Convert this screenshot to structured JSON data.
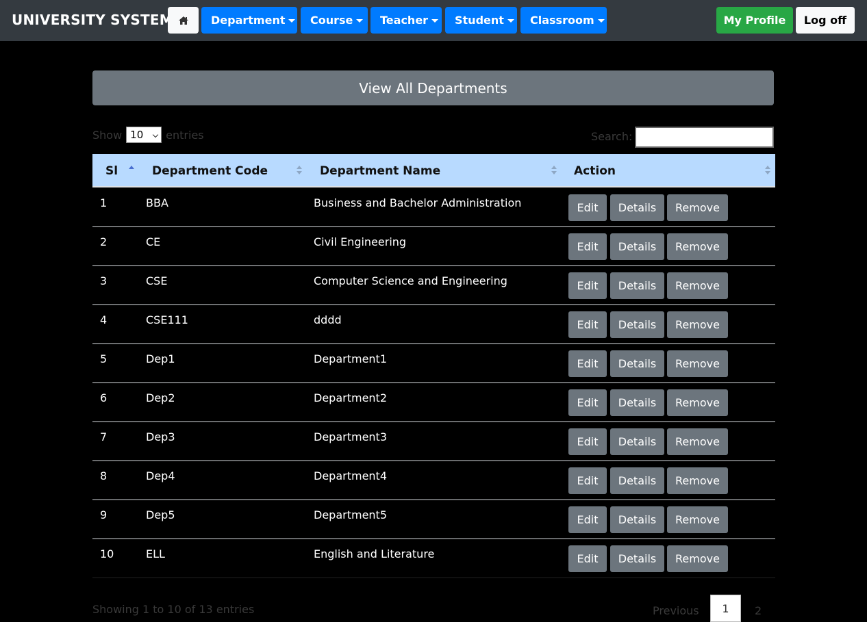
{
  "navbar": {
    "brand": "UNIVERSITY SYSTEM",
    "home_icon": "home-icon",
    "menus": [
      {
        "label": "Department"
      },
      {
        "label": "Course"
      },
      {
        "label": "Teacher"
      },
      {
        "label": "Student"
      },
      {
        "label": "Classroom"
      }
    ],
    "my_profile": "My Profile",
    "log_off": "Log off",
    "colors": {
      "bar": "#343a40",
      "menu": "#007bff",
      "profile": "#28a745"
    }
  },
  "page": {
    "title": "View All Departments"
  },
  "table_controls": {
    "show_label": "Show",
    "page_size": "10",
    "entries_label": "entries",
    "search_label": "Search:",
    "search_value": ""
  },
  "table": {
    "headers": [
      "Sl",
      "Department Code",
      "Department Name",
      "Action"
    ],
    "header_color": "#b8daff",
    "sort_column": "Sl",
    "sort_direction": "ascending",
    "rows": [
      {
        "sl": "1",
        "code": "BBA",
        "name": "Business and Bachelor Administration"
      },
      {
        "sl": "2",
        "code": "CE",
        "name": "Civil Engineering"
      },
      {
        "sl": "3",
        "code": "CSE",
        "name": "Computer Science and Engineering"
      },
      {
        "sl": "4",
        "code": "CSE111",
        "name": "dddd"
      },
      {
        "sl": "5",
        "code": "Dep1",
        "name": "Department1"
      },
      {
        "sl": "6",
        "code": "Dep2",
        "name": "Department2"
      },
      {
        "sl": "7",
        "code": "Dep3",
        "name": "Department3"
      },
      {
        "sl": "8",
        "code": "Dep4",
        "name": "Department4"
      },
      {
        "sl": "9",
        "code": "Dep5",
        "name": "Department5"
      },
      {
        "sl": "10",
        "code": "ELL",
        "name": "English and Literature"
      }
    ],
    "actions": {
      "edit": "Edit",
      "details": "Details",
      "remove": "Remove"
    }
  },
  "footer": {
    "info": "Showing 1 to 10 of 13 entries",
    "previous": "Previous",
    "pages": [
      "1",
      "2"
    ],
    "current_page": "1"
  }
}
